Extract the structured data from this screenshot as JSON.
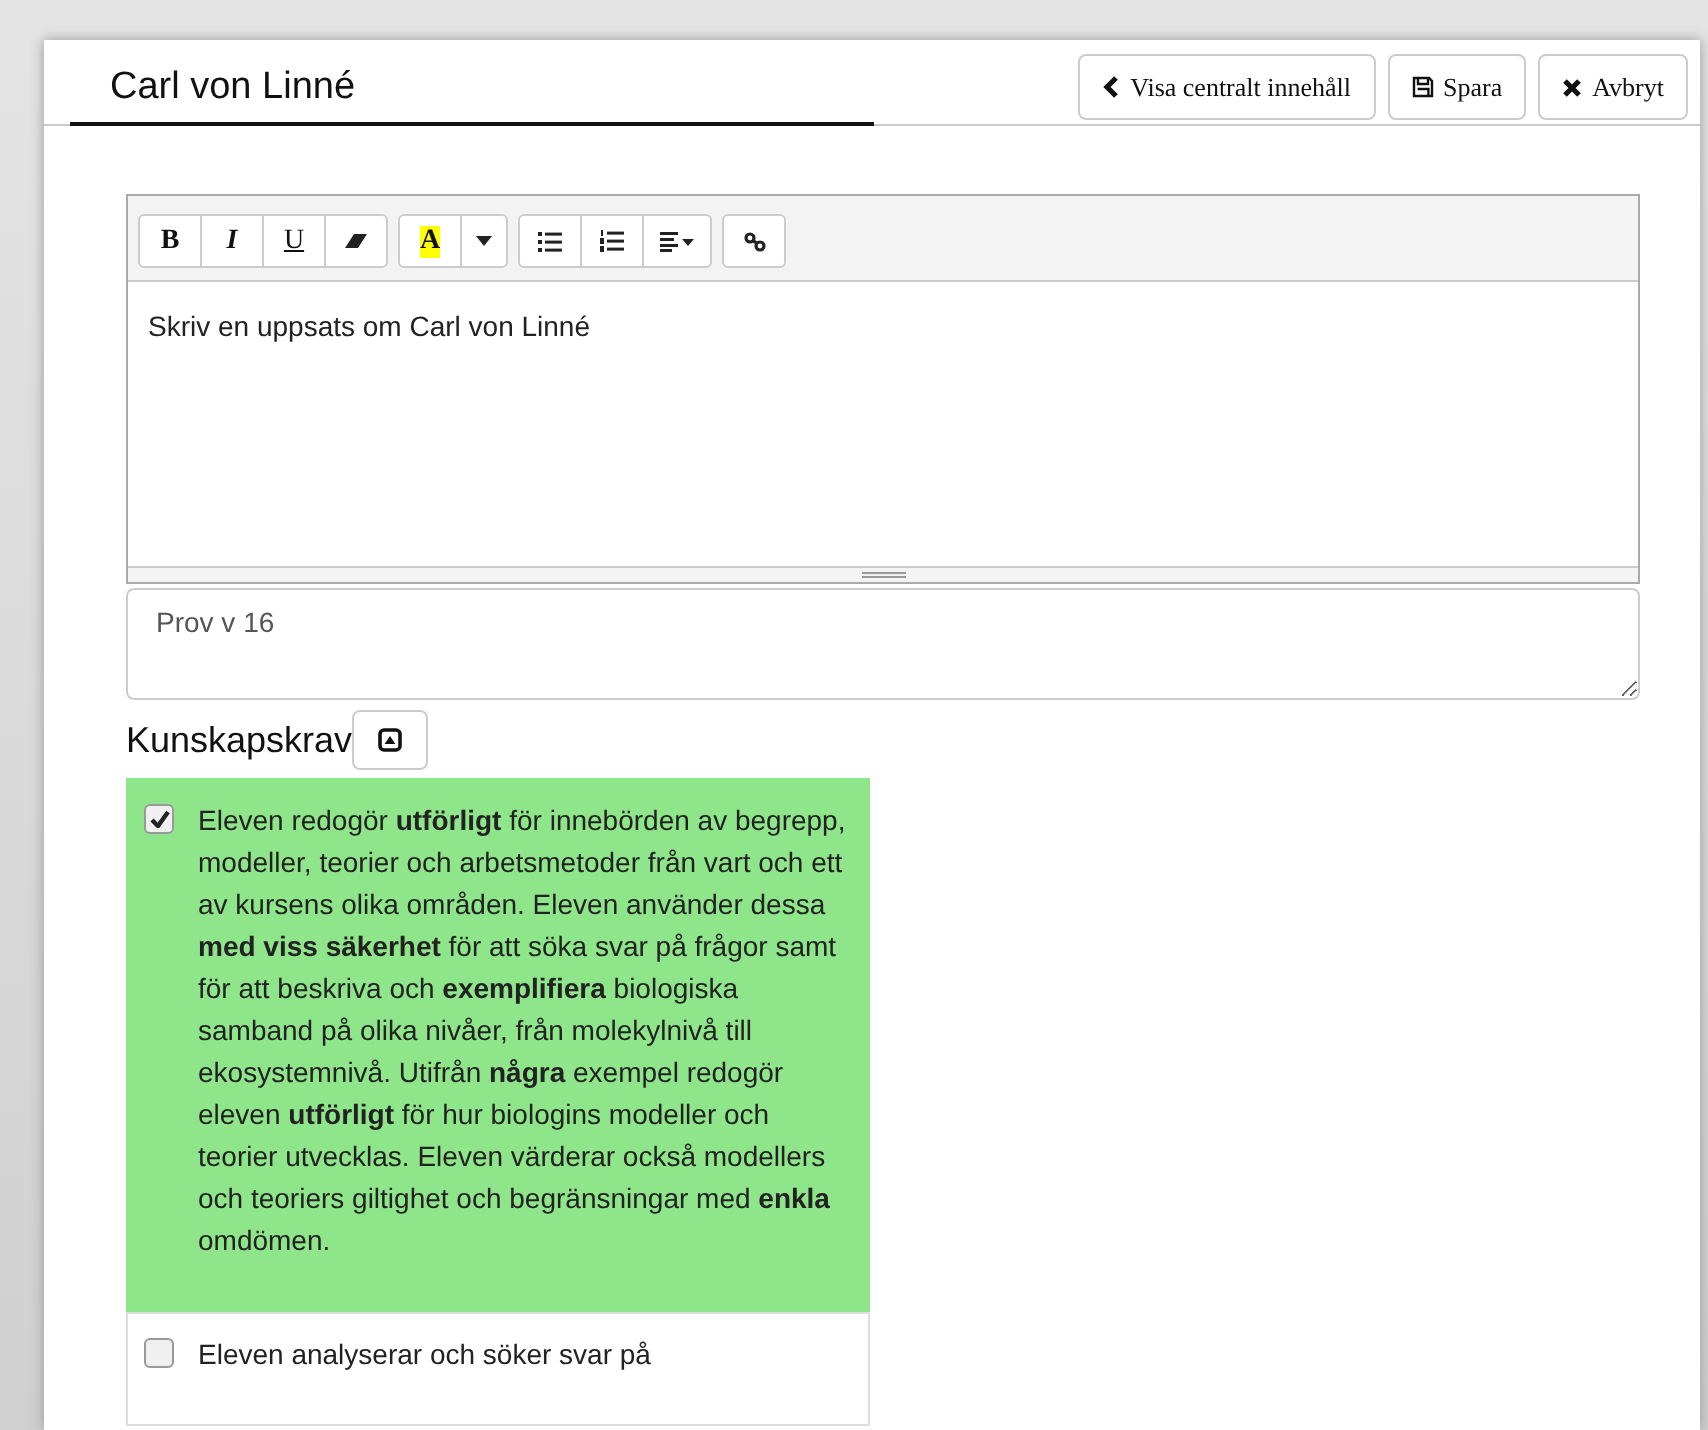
{
  "title": "Carl von Linné",
  "header_buttons": [
    {
      "kind": "back",
      "label": "Visa centralt innehåll"
    },
    {
      "kind": "save",
      "label": "Spara"
    },
    {
      "kind": "cancel",
      "label": "Avbryt"
    }
  ],
  "toolbar": [
    [
      {
        "kind": "bold",
        "label": "B"
      },
      {
        "kind": "italic",
        "label": "I"
      },
      {
        "kind": "underline",
        "label": "U"
      },
      {
        "kind": "eraser"
      }
    ],
    [
      {
        "kind": "highlight",
        "label": "A"
      },
      {
        "kind": "caret"
      }
    ],
    [
      {
        "kind": "bullets"
      },
      {
        "kind": "numbers"
      },
      {
        "kind": "align"
      }
    ],
    [
      {
        "kind": "link"
      }
    ]
  ],
  "editor": {
    "value": "Skriv en uppsats om Carl von Linné"
  },
  "note": {
    "value": "Prov v 16"
  },
  "section": {
    "title": "Kunskapskrav"
  },
  "requirements": [
    {
      "checked": true,
      "text": "Eleven redogör **utförligt** för innebörden av begrepp, modeller, teorier och arbetsmetoder från vart och ett av kursens olika områden. Eleven använder dessa **med viss säkerhet** för att söka svar på frågor samt för att beskriva och **exemplifiera** biologiska samband på olika nivåer, från molekylnivå till ekosystemnivå. Utifrån **några** exempel redogör eleven **utförligt** för hur biologins modeller och teorier utvecklas. Eleven värderar också modellers och teoriers giltighet och begränsningar med **enkla** omdömen."
    },
    {
      "checked": false,
      "text": "Eleven analyserar och söker svar på"
    }
  ]
}
